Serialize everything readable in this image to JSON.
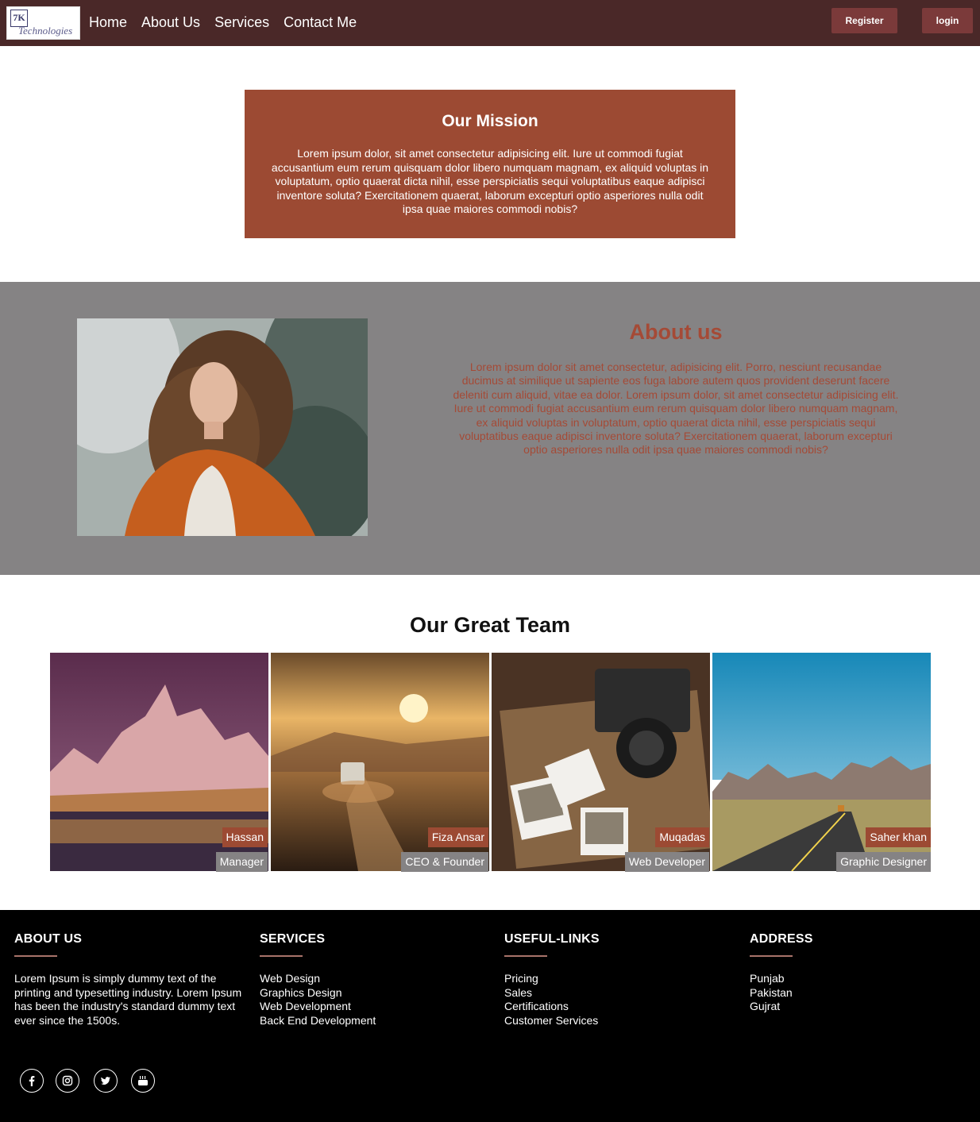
{
  "navbar": {
    "logo_mark": "7K",
    "logo_text": "Technologies",
    "links": [
      "Home",
      "About Us",
      "Services",
      "Contact Me"
    ],
    "register_label": "Register",
    "login_label": "login",
    "bg_color": "#4a2828"
  },
  "mission": {
    "title": "Our Mission",
    "text": "Lorem ipsum dolor, sit amet consectetur adipisicing elit. Iure ut commodi fugiat accusantium eum rerum quisquam dolor libero numquam magnam, ex aliquid voluptas in voluptatum, optio quaerat dicta nihil, esse perspiciatis sequi voluptatibus eaque adipisci inventore soluta? Exercitationem quaerat, laborum excepturi optio asperiores nulla odit ipsa quae maiores commodi nobis?",
    "bg_color": "#9c4a33"
  },
  "about": {
    "title": "About us",
    "text": "Lorem ipsum dolor sit amet consectetur, adipisicing elit. Porro, nesciunt recusandae ducimus at similique ut sapiente eos fuga labore autem quos provident deserunt facere deleniti cum aliquid, vitae ea dolor. Lorem ipsum dolor, sit amet consectetur adipisicing elit. Iure ut commodi fugiat accusantium eum rerum quisquam dolor libero numquam magnam, ex aliquid voluptas in voluptatum, optio quaerat dicta nihil, esse perspiciatis sequi voluptatibus eaque adipisci inventore soluta? Exercitationem quaerat, laborum excepturi optio asperiores nulla odit ipsa quae maiores commodi nobis?",
    "accent_color": "#a54a36"
  },
  "team": {
    "title": "Our Great Team",
    "members": [
      {
        "name": "Hassan",
        "role": "Manager"
      },
      {
        "name": "Fiza Ansar",
        "role": "CEO & Founder"
      },
      {
        "name": "Muqadas",
        "role": "Web Developer"
      },
      {
        "name": "Saher khan",
        "role": "Graphic Designer"
      }
    ]
  },
  "footer": {
    "about": {
      "title": "ABOUT US",
      "text": "Lorem Ipsum is simply dummy text of the printing and typesetting industry. Lorem Ipsum has been the industry's standard dummy text ever since the 1500s."
    },
    "services": {
      "title": "SERVICES",
      "items": [
        "Web Design",
        "Graphics Design",
        "Web Development",
        "Back End Development"
      ]
    },
    "links": {
      "title": "USEFUL-LINKS",
      "items": [
        "Pricing",
        "Sales",
        "Certifications",
        "Customer Services"
      ]
    },
    "address": {
      "title": "ADDRESS",
      "items": [
        "Punjab",
        "Pakistan",
        "Gujrat"
      ]
    },
    "social_icons": [
      "facebook-icon",
      "instagram-icon",
      "twitter-icon",
      "youtube-icon"
    ]
  }
}
